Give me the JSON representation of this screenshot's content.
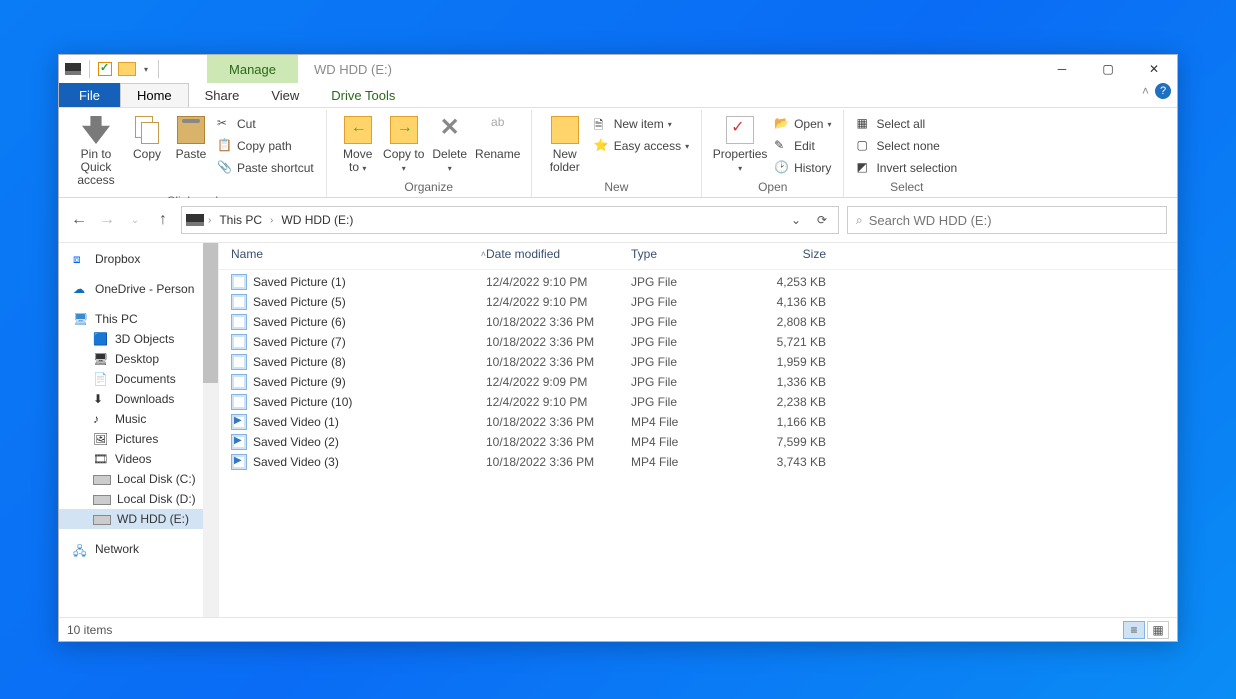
{
  "titlebar": {
    "manage": "Manage",
    "title": "WD HDD (E:)"
  },
  "tabs": {
    "file": "File",
    "home": "Home",
    "share": "Share",
    "view": "View",
    "drive_tools": "Drive Tools"
  },
  "ribbon": {
    "clipboard": {
      "label": "Clipboard",
      "pin": "Pin to Quick access",
      "copy": "Copy",
      "paste": "Paste",
      "cut": "Cut",
      "copy_path": "Copy path",
      "paste_shortcut": "Paste shortcut"
    },
    "organize": {
      "label": "Organize",
      "move_to": "Move to",
      "copy_to": "Copy to",
      "delete": "Delete",
      "rename": "Rename"
    },
    "new": {
      "label": "New",
      "new_folder": "New folder",
      "new_item": "New item",
      "easy_access": "Easy access"
    },
    "open": {
      "label": "Open",
      "properties": "Properties",
      "open": "Open",
      "edit": "Edit",
      "history": "History"
    },
    "select": {
      "label": "Select",
      "select_all": "Select all",
      "select_none": "Select none",
      "invert": "Invert selection"
    }
  },
  "breadcrumb": {
    "this_pc": "This PC",
    "drive": "WD HDD (E:)"
  },
  "search": {
    "placeholder": "Search WD HDD (E:)"
  },
  "sidebar": {
    "dropbox": "Dropbox",
    "onedrive": "OneDrive - Person",
    "this_pc": "This PC",
    "children": [
      "3D Objects",
      "Desktop",
      "Documents",
      "Downloads",
      "Music",
      "Pictures",
      "Videos",
      "Local Disk (C:)",
      "Local Disk (D:)",
      "WD HDD (E:)"
    ],
    "network": "Network"
  },
  "columns": {
    "name": "Name",
    "modified": "Date modified",
    "type": "Type",
    "size": "Size"
  },
  "files": [
    {
      "name": "Saved Picture (1)",
      "modified": "12/4/2022 9:10 PM",
      "type": "JPG File",
      "size": "4,253 KB",
      "kind": "pic"
    },
    {
      "name": "Saved Picture (5)",
      "modified": "12/4/2022 9:10 PM",
      "type": "JPG File",
      "size": "4,136 KB",
      "kind": "pic"
    },
    {
      "name": "Saved Picture (6)",
      "modified": "10/18/2022 3:36 PM",
      "type": "JPG File",
      "size": "2,808 KB",
      "kind": "pic"
    },
    {
      "name": "Saved Picture (7)",
      "modified": "10/18/2022 3:36 PM",
      "type": "JPG File",
      "size": "5,721 KB",
      "kind": "pic"
    },
    {
      "name": "Saved Picture (8)",
      "modified": "10/18/2022 3:36 PM",
      "type": "JPG File",
      "size": "1,959 KB",
      "kind": "pic"
    },
    {
      "name": "Saved Picture (9)",
      "modified": "12/4/2022 9:09 PM",
      "type": "JPG File",
      "size": "1,336 KB",
      "kind": "pic"
    },
    {
      "name": "Saved Picture (10)",
      "modified": "12/4/2022 9:10 PM",
      "type": "JPG File",
      "size": "2,238 KB",
      "kind": "pic"
    },
    {
      "name": "Saved Video (1)",
      "modified": "10/18/2022 3:36 PM",
      "type": "MP4 File",
      "size": "1,166 KB",
      "kind": "vid"
    },
    {
      "name": "Saved Video (2)",
      "modified": "10/18/2022 3:36 PM",
      "type": "MP4 File",
      "size": "7,599 KB",
      "kind": "vid"
    },
    {
      "name": "Saved Video (3)",
      "modified": "10/18/2022 3:36 PM",
      "type": "MP4 File",
      "size": "3,743 KB",
      "kind": "vid"
    }
  ],
  "status": {
    "count": "10 items"
  }
}
